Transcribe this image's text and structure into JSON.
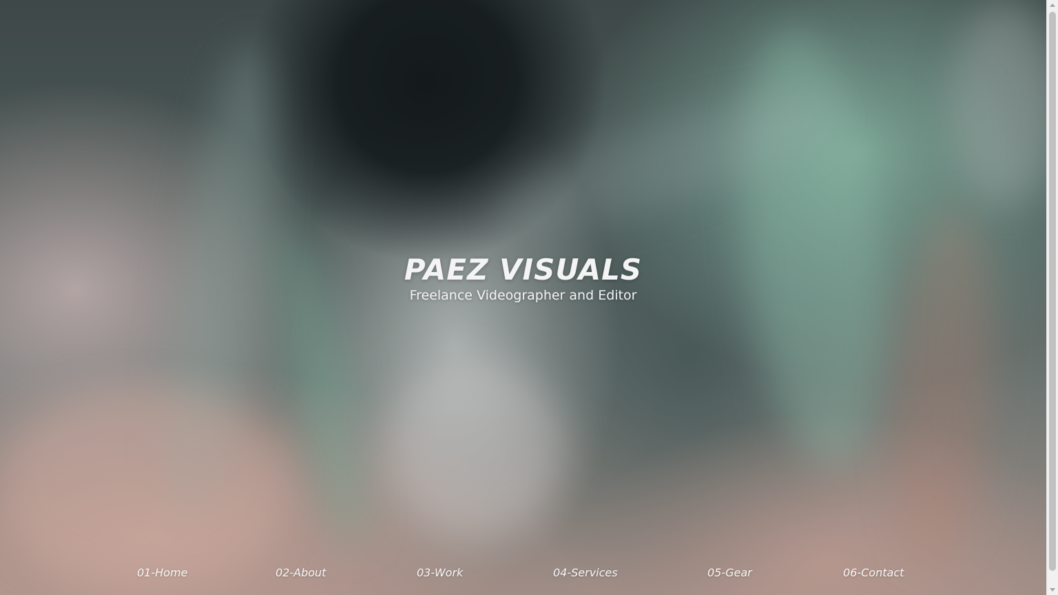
{
  "hero": {
    "title": "PAEZ VISUALS",
    "subtitle": "Freelance Videographer and Editor",
    "background": "smoke-background-image"
  },
  "nav": {
    "items": [
      {
        "label": "01-Home"
      },
      {
        "label": "02-About"
      },
      {
        "label": "03-Work"
      },
      {
        "label": "04-Services"
      },
      {
        "label": "05-Gear"
      },
      {
        "label": "06-Contact"
      }
    ]
  },
  "colors": {
    "text": "#f4f4f4",
    "scrollbar_track": "#f1f1f1",
    "scrollbar_thumb": "#c1c1c1"
  }
}
